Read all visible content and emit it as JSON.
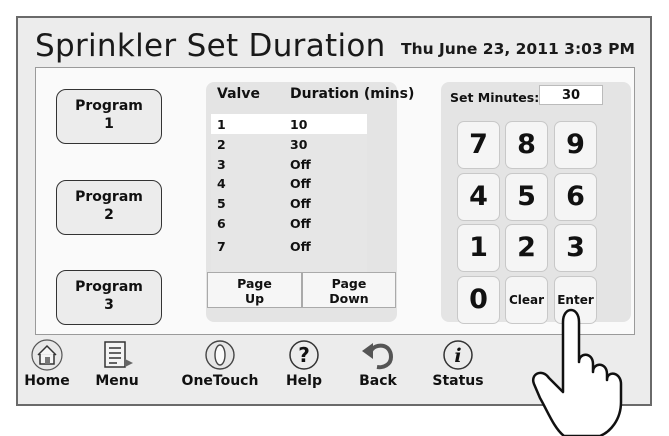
{
  "header": {
    "title": "Sprinkler Set Duration",
    "datetime": "Thu June 23, 2011  3:03 PM"
  },
  "programs": [
    {
      "line1": "Program",
      "line2": "1"
    },
    {
      "line1": "Program",
      "line2": "2"
    },
    {
      "line1": "Program",
      "line2": "3"
    }
  ],
  "valve_table": {
    "col_valve": "Valve",
    "col_duration": "Duration (mins)",
    "rows": [
      {
        "valve": "1",
        "duration": "10",
        "selected": true
      },
      {
        "valve": "2",
        "duration": "30"
      },
      {
        "valve": "3",
        "duration": "Off"
      },
      {
        "valve": "4",
        "duration": "Off"
      },
      {
        "valve": "5",
        "duration": "Off"
      },
      {
        "valve": "6",
        "duration": "Off"
      },
      {
        "valve": "7",
        "duration": "Off"
      }
    ],
    "page_up": {
      "line1": "Page",
      "line2": "Up"
    },
    "page_down": {
      "line1": "Page",
      "line2": "Down"
    }
  },
  "keypad": {
    "set_minutes_label": "Set Minutes:",
    "set_minutes_value": "30",
    "keys": [
      "7",
      "8",
      "9",
      "4",
      "5",
      "6",
      "1",
      "2",
      "3",
      "0",
      "Clear",
      "Enter"
    ]
  },
  "toolbar": {
    "items": [
      {
        "label": "Home",
        "icon": "home-icon"
      },
      {
        "label": "Menu",
        "icon": "menu-icon"
      },
      {
        "label": "OneTouch",
        "icon": "onetouch-icon"
      },
      {
        "label": "Help",
        "icon": "help-icon"
      },
      {
        "label": "Back",
        "icon": "back-icon"
      },
      {
        "label": "Status",
        "icon": "status-icon"
      }
    ]
  }
}
